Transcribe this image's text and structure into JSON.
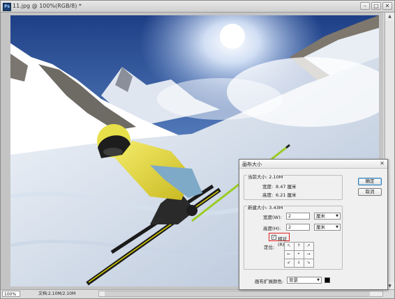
{
  "window": {
    "title": "11.jpg @ 100%(RGB/8) *",
    "app_icon": "Ps",
    "buttons": [
      "–",
      "□",
      "✕"
    ]
  },
  "status": {
    "zoom": "100%",
    "doc_info": "文档:2.10M/2.10M"
  },
  "dialog": {
    "title": "画布大小",
    "close": "✕",
    "current_size": {
      "header": "当前大小: 2.10M",
      "width_label": "宽度:",
      "width_value": "8.47 厘米",
      "height_label": "高度:",
      "height_value": "6.21 厘米"
    },
    "new_size": {
      "header": "新建大小: 3.43M",
      "width_label": "宽度(W):",
      "width_value": "2",
      "width_unit": "厘米",
      "height_label": "高度(H):",
      "height_value": "2",
      "height_unit": "厘米",
      "relative_label": "相对(R)",
      "relative_checked": "✓",
      "anchor_label": "定位:",
      "anchor_arrows": [
        "↖",
        "↑",
        "↗",
        "←",
        "•",
        "→",
        "↙",
        "↓",
        "↘"
      ]
    },
    "extension_color_label": "画布扩展颜色:",
    "extension_color_value": "背景",
    "extension_swatch": "#000000",
    "ok_label": "确定",
    "cancel_label": "取消"
  }
}
